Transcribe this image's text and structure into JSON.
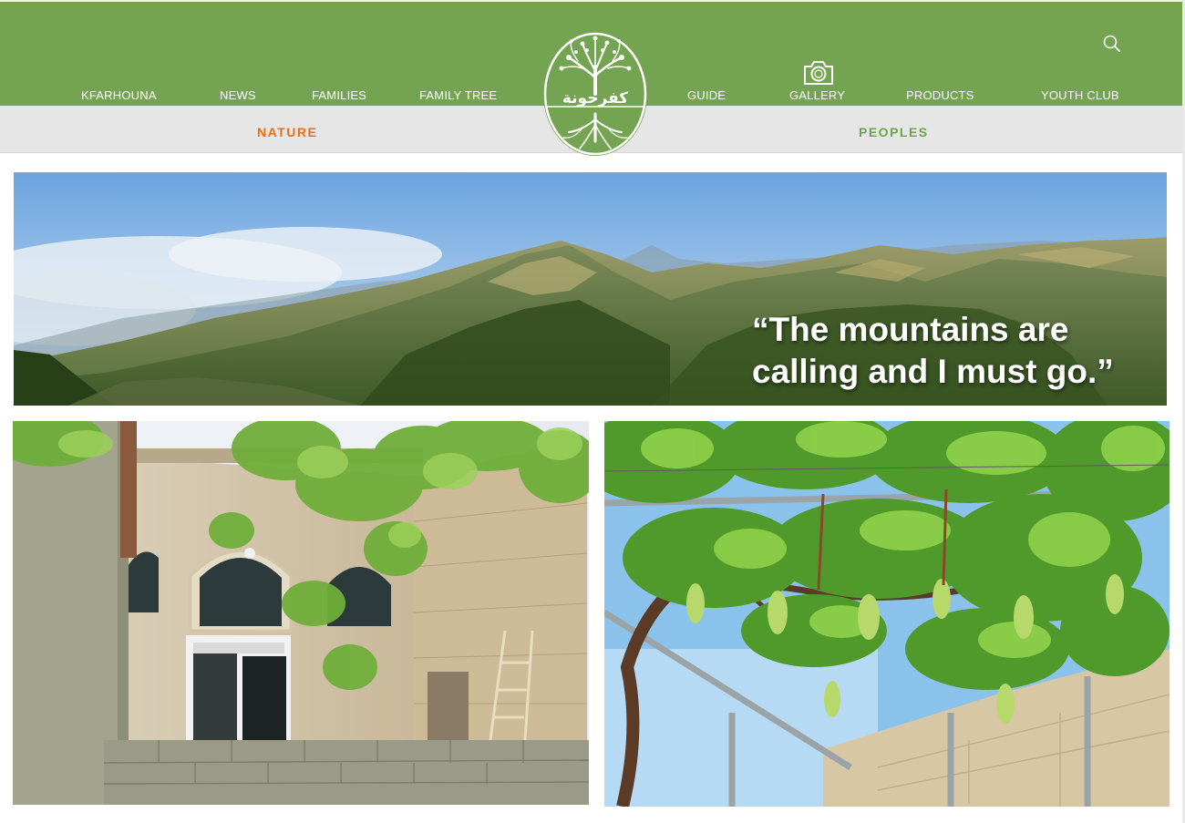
{
  "header": {
    "nav_left": [
      {
        "label": "KFARHOUNA"
      },
      {
        "label": "NEWS"
      },
      {
        "label": "FAMILIES"
      },
      {
        "label": "FAMILY TREE"
      }
    ],
    "nav_right": [
      {
        "label": "GUIDE"
      },
      {
        "label": "GALLERY",
        "icon": "camera-icon"
      },
      {
        "label": "PRODUCTS"
      },
      {
        "label": "YOUTH CLUB"
      }
    ],
    "search_icon": "search-icon",
    "logo": {
      "text": "كفرحونة",
      "icon": "tree-logo"
    }
  },
  "subnav": {
    "items": [
      {
        "label": "NATURE",
        "active": true,
        "color": "#f26b0f"
      },
      {
        "label": "PEOPLES",
        "active": false,
        "color": "#6ea347"
      }
    ]
  },
  "hero": {
    "quote_line1": "“The mountains are",
    "quote_line2": "calling and I must go.”"
  },
  "colors": {
    "header_green": "#74a451",
    "subbar_grey": "#e6e6e6",
    "active_orange": "#f26b0f",
    "inactive_green": "#6ea347"
  }
}
